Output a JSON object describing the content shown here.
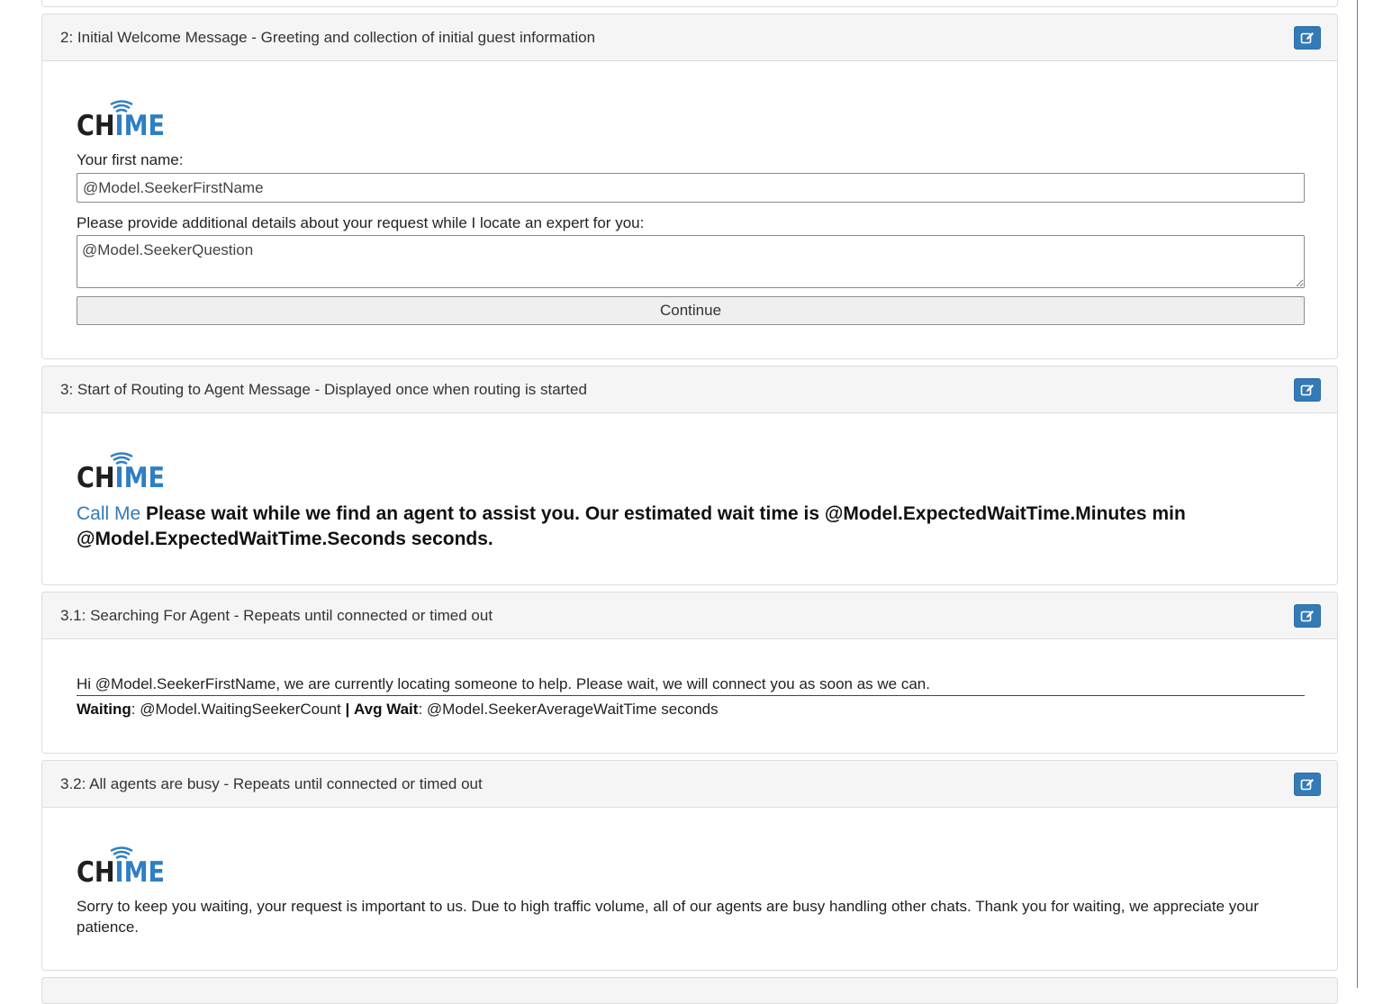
{
  "panels": [
    {
      "title": "2: Initial Welcome Message - Greeting and collection of initial guest information",
      "logo_text": "CHIME",
      "first_name_label": "Your first name:",
      "first_name_value": "@Model.SeekerFirstName",
      "details_label": "Please provide additional details about your request while I locate an expert for you:",
      "details_value": "@Model.SeekerQuestion",
      "continue_label": "Continue"
    },
    {
      "title": "3: Start of Routing to Agent Message - Displayed once when routing is started",
      "logo_text": "CHIME",
      "link_text": "Call Me",
      "message": "Please wait while we find an agent to assist you. Our estimated wait time is @Model.ExpectedWaitTime.Minutes min @Model.ExpectedWaitTime.Seconds seconds."
    },
    {
      "title": "3.1: Searching For Agent - Repeats until connected or timed out",
      "message": "Hi @Model.SeekerFirstName, we are currently locating someone to help. Please wait, we will connect you as soon as we can.",
      "waiting_label": "Waiting",
      "waiting_value": ": @Model.WaitingSeekerCount ",
      "separator": "|",
      "avg_wait_label": "Avg Wait",
      "avg_wait_value": ": @Model.SeekerAverageWaitTime seconds"
    },
    {
      "title": "3.2: All agents are busy - Repeats until connected or timed out",
      "logo_text": "CHIME",
      "message": "Sorry to keep you waiting, your request is important to us. Due to high traffic volume, all of our agents are busy handling other chats. Thank you for waiting, we appreciate your patience."
    }
  ],
  "colors": {
    "accent": "#337ab7",
    "logo_dark": "#1f1f1f",
    "logo_blue": "#2f7fc4"
  },
  "icons": {
    "edit": "edit-icon"
  }
}
